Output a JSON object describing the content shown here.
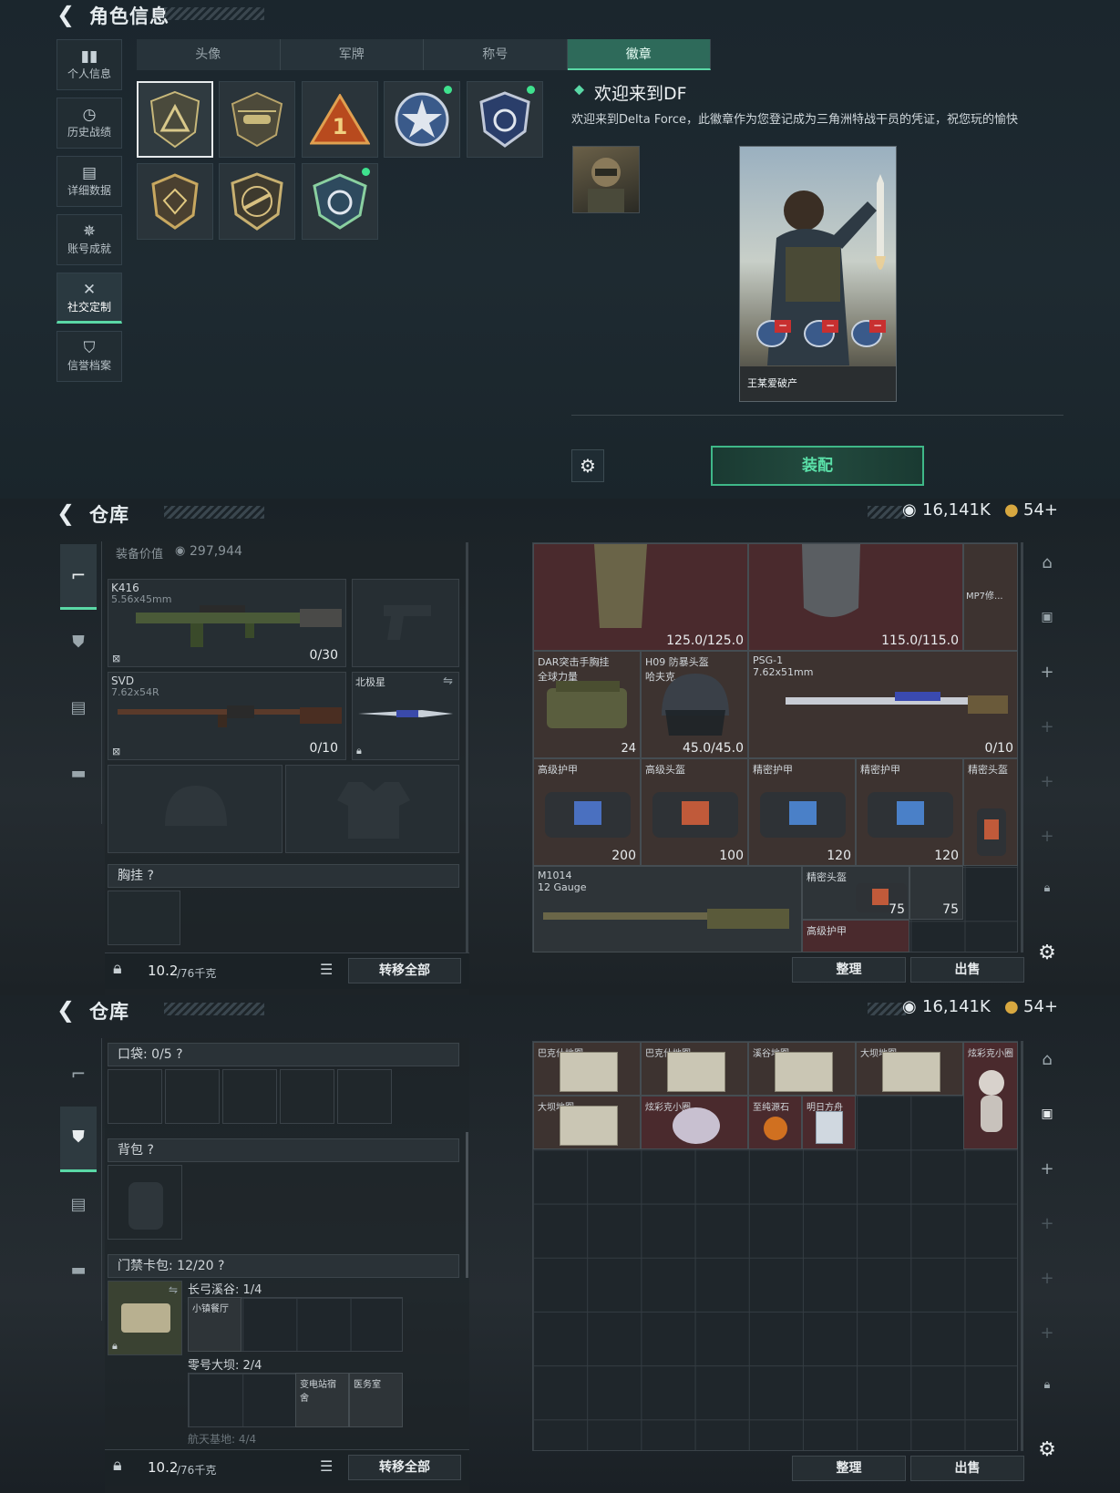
{
  "panel1": {
    "title": "角色信息",
    "sidebar": [
      "个人信息",
      "历史战绩",
      "详细数据",
      "账号成就",
      "社交定制",
      "信誉档案"
    ],
    "tabs": [
      "头像",
      "军牌",
      "称号",
      "徽章"
    ],
    "badge_title": "欢迎来到DF",
    "badge_desc": "欢迎来到Delta Force，此徽章作为您登记成为三角洲特战干员的凭证，祝您玩的愉快",
    "preview_name": "王某爱破产",
    "equip_button": "装配"
  },
  "currency": {
    "coins": "16,141K",
    "tokens": "54+"
  },
  "panel2": {
    "title": "仓库",
    "equip_value_label": "装备价值",
    "equip_value": "297,944",
    "weapons": [
      {
        "name": "K416",
        "caliber": "5.56x45mm",
        "ammo": "0/30"
      },
      {
        "name": "SVD",
        "caliber": "7.62x54R",
        "ammo": "0/10"
      },
      {
        "name": "北极星",
        "caliber": "",
        "ammo": ""
      }
    ],
    "chest_rig_label": "胸挂 ?",
    "weight": "10.2",
    "weight_unit": "/76千克",
    "transfer_all": "转移全部",
    "sort": "整理",
    "sell": "出售",
    "stash_items": [
      {
        "name": "",
        "value": "125.0/125.0"
      },
      {
        "name": "",
        "value": "115.0/115.0"
      },
      {
        "name": "MP7修...",
        "value": ""
      },
      {
        "name": "DAR突击手胸挂",
        "sub": "全球力量",
        "value": "24"
      },
      {
        "name": "H09 防暴头盔",
        "sub": "哈夫克",
        "value": "45.0/45.0"
      },
      {
        "name": "PSG-1",
        "sub": "7.62x51mm",
        "value": "0/10"
      },
      {
        "name": "高级护甲",
        "value": "200"
      },
      {
        "name": "高级头盔",
        "value": "100"
      },
      {
        "name": "精密护甲",
        "value": "120"
      },
      {
        "name": "精密护甲",
        "value": "120"
      },
      {
        "name": "精密头盔",
        "value": ""
      },
      {
        "name": "M1014",
        "sub": "12 Gauge",
        "value": ""
      },
      {
        "name": "精密头盔",
        "value": "75"
      },
      {
        "name": "",
        "value": "75"
      },
      {
        "name": "高级护甲",
        "value": ""
      }
    ]
  },
  "panel3": {
    "title": "仓库",
    "pocket_label": "口袋: 0/5 ?",
    "backpack_label": "背包 ?",
    "keycard_label": "门禁卡包: 12/20 ?",
    "map1": "长弓溪谷: 1/4",
    "map1_item": "小镇餐厅",
    "map2": "零号大坝: 2/4",
    "map2_items": [
      "变电站宿舍",
      "医务室"
    ],
    "map3": "航天基地: 4/4",
    "weight": "10.2",
    "weight_unit": "/76千克",
    "transfer_all": "转移全部",
    "sort": "整理",
    "sell": "出售",
    "stash_items": [
      "巴克什地图",
      "巴克什地图",
      "溪谷地图",
      "大坝地图",
      "炫彩克小圈",
      "大坝地图",
      "炫彩克小圈",
      "至纯源石",
      "明日方舟"
    ]
  }
}
